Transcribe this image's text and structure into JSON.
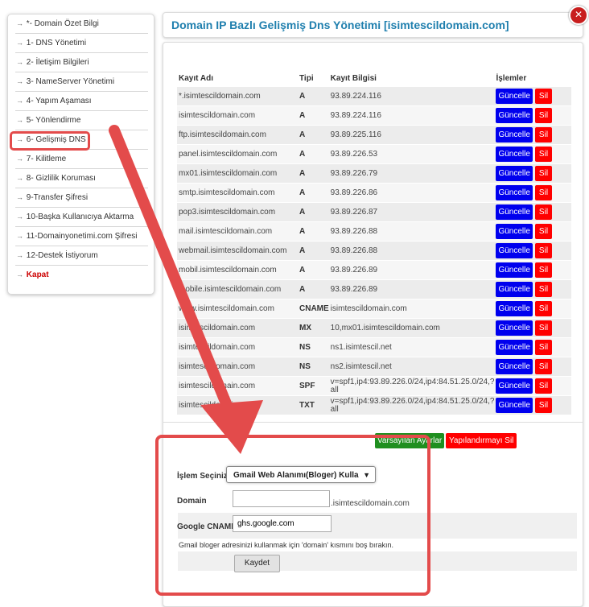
{
  "sidebar": {
    "items": [
      {
        "label": "*- Domain Özet Bilgi"
      },
      {
        "label": "1- DNS Yönetimi"
      },
      {
        "label": "2- İletişim Bilgileri"
      },
      {
        "label": "3- NameServer Yönetimi"
      },
      {
        "label": "4- Yapım Aşaması"
      },
      {
        "label": "5- Yönlendirme"
      },
      {
        "label": "6- Gelişmiş DNS"
      },
      {
        "label": "7- Kilitleme"
      },
      {
        "label": "8- Gizlilik Koruması"
      },
      {
        "label": "9-Transfer Şifresi"
      },
      {
        "label": "10-Başka Kullanıcıya Aktarma"
      },
      {
        "label": "11-Domainyonetimi.com Şifresi"
      },
      {
        "label": "12-Destek İstiyorum"
      },
      {
        "label": "Kapat"
      }
    ]
  },
  "header": {
    "title": "Domain IP Bazlı Gelişmiş Dns Yönetimi [isimtescildomain.com]"
  },
  "table": {
    "columns": [
      "Kayıt Adı",
      "Tipi",
      "Kayıt Bilgisi",
      "İşlemler"
    ],
    "update_label": "Güncelle",
    "delete_label": "Sil",
    "rows": [
      {
        "name": "*.isimtescildomain.com",
        "type": "A",
        "value": "93.89.224.116"
      },
      {
        "name": "isimtescildomain.com",
        "type": "A",
        "value": "93.89.224.116"
      },
      {
        "name": "ftp.isimtescildomain.com",
        "type": "A",
        "value": "93.89.225.116"
      },
      {
        "name": "panel.isimtescildomain.com",
        "type": "A",
        "value": "93.89.226.53"
      },
      {
        "name": "mx01.isimtescildomain.com",
        "type": "A",
        "value": "93.89.226.79"
      },
      {
        "name": "smtp.isimtescildomain.com",
        "type": "A",
        "value": "93.89.226.86"
      },
      {
        "name": "pop3.isimtescildomain.com",
        "type": "A",
        "value": "93.89.226.87"
      },
      {
        "name": "mail.isimtescildomain.com",
        "type": "A",
        "value": "93.89.226.88"
      },
      {
        "name": "webmail.isimtescildomain.com",
        "type": "A",
        "value": "93.89.226.88"
      },
      {
        "name": "mobil.isimtescildomain.com",
        "type": "A",
        "value": "93.89.226.89"
      },
      {
        "name": "mobile.isimtescildomain.com",
        "type": "A",
        "value": "93.89.226.89"
      },
      {
        "name": "www.isimtescildomain.com",
        "type": "CNAME",
        "value": "isimtescildomain.com"
      },
      {
        "name": "isimtescildomain.com",
        "type": "MX",
        "value": "10,mx01.isimtescildomain.com"
      },
      {
        "name": "isimtescildomain.com",
        "type": "NS",
        "value": "ns1.isimtescil.net"
      },
      {
        "name": "isimtescildomain.com",
        "type": "NS",
        "value": "ns2.isimtescil.net"
      },
      {
        "name": "isimtescildomain.com",
        "type": "SPF",
        "value": "v=spf1,ip4:93.89.226.0/24,ip4:84.51.25.0/24,?all"
      },
      {
        "name": "isimtescildomain.com",
        "type": "TXT",
        "value": "v=spf1,ip4:93.89.226.0/24,ip4:84.51.25.0/24,?all"
      }
    ]
  },
  "actions": {
    "defaults_label": "Varsayılan Ayarlar",
    "delete_config_label": "Yapılandırmayı Sil"
  },
  "form": {
    "select_label": "İşlem Seçiniz",
    "select_value": "Gmail Web Alanımı(Bloger) Kulla",
    "domain_label": "Domain",
    "domain_value": "",
    "domain_suffix": ".isimtescildomain.com",
    "cname_label": "Google CNAME",
    "cname_value": "ghs.google.com",
    "info": "Gmail bloger adresinizi kullanmak için 'domain' kısmını boş bırakın.",
    "save_label": "Kaydet"
  },
  "colors": {
    "accent": "#1f7fae",
    "update": "#0000ee",
    "delete": "#ff0000",
    "default": "#1f8f1f",
    "annotation": "#e34b4b"
  }
}
